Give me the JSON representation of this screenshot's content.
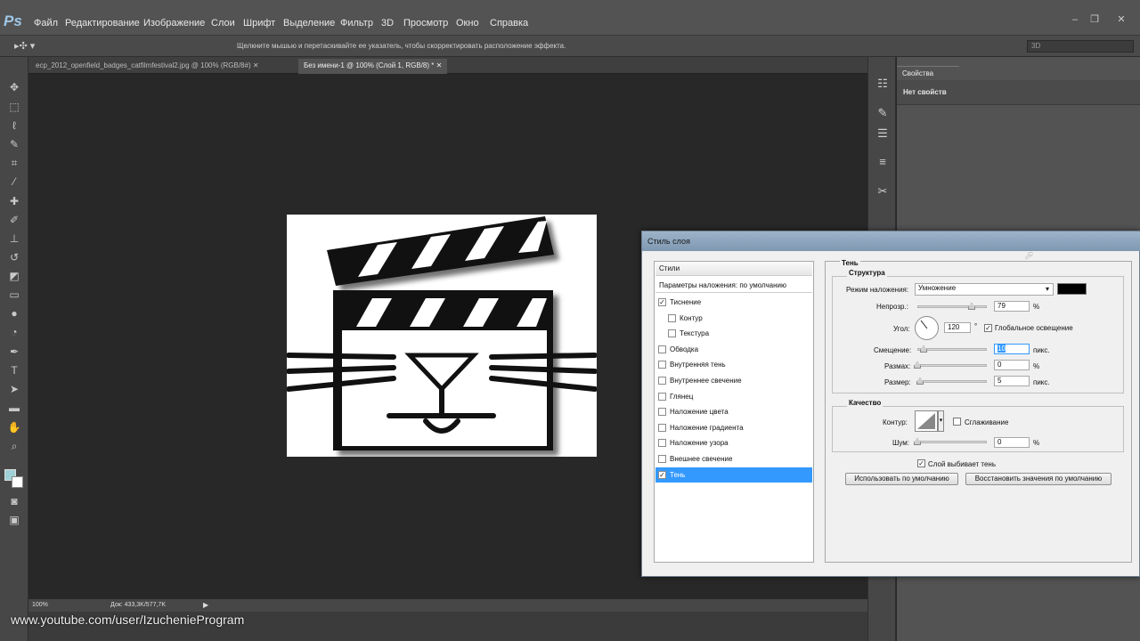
{
  "app": {
    "logo": "Ps"
  },
  "menu": [
    "Файл",
    "Редактирование",
    "Изображение",
    "Слои",
    "Шрифт",
    "Выделение",
    "Фильтр",
    "3D",
    "Просмотр",
    "Окно",
    "Справка"
  ],
  "options": {
    "hint": "Щелкните мышью и перетаскивайте ее указатель, чтобы скорректировать расположение эффекта.",
    "mode_3d": "3D"
  },
  "tabs": [
    {
      "label": "ecp_2012_openfield_badges_catfilmfestival2.jpg @ 100% (RGB/8#)"
    },
    {
      "label": "Без имени-1 @ 100% (Слой 1, RGB/8) *"
    }
  ],
  "status": {
    "zoom": "100%",
    "doc": "Док: 433,3K/577,7K"
  },
  "watermark": "www.youtube.com/user/IzuchenieProgram",
  "properties": {
    "tab": "Свойства",
    "empty": "Нет свойств"
  },
  "dialog": {
    "title": "Стиль слоя",
    "styles_header": "Стили",
    "blend_defaults": "Параметры наложения: по умолчанию",
    "styles": [
      {
        "label": "Тиснение",
        "checked": true,
        "indent": false
      },
      {
        "label": "Контур",
        "checked": false,
        "indent": true
      },
      {
        "label": "Текстура",
        "checked": false,
        "indent": true
      },
      {
        "label": "Обводка",
        "checked": false,
        "indent": false
      },
      {
        "label": "Внутренняя тень",
        "checked": false,
        "indent": false
      },
      {
        "label": "Внутреннее свечение",
        "checked": false,
        "indent": false
      },
      {
        "label": "Глянец",
        "checked": false,
        "indent": false
      },
      {
        "label": "Наложение цвета",
        "checked": false,
        "indent": false
      },
      {
        "label": "Наложение градиента",
        "checked": false,
        "indent": false
      },
      {
        "label": "Наложение узора",
        "checked": false,
        "indent": false
      },
      {
        "label": "Внешнее свечение",
        "checked": false,
        "indent": false
      },
      {
        "label": "Тень",
        "checked": true,
        "indent": false,
        "selected": true
      }
    ],
    "shadow": {
      "section": "Тень",
      "structure": "Структура",
      "blend_mode_label": "Режим наложения:",
      "blend_mode": "Умножение",
      "shadow_color": "#000000",
      "opacity_label": "Непрозр.:",
      "opacity": "79",
      "opacity_unit": "%",
      "angle_label": "Угол:",
      "angle": "120",
      "angle_unit": "°",
      "global_light_label": "Глобальное освещение",
      "global_light": true,
      "distance_label": "Смещение:",
      "distance": "10",
      "distance_unit": "пикс.",
      "spread_label": "Размах:",
      "spread": "0",
      "spread_unit": "%",
      "size_label": "Размер:",
      "size": "5",
      "size_unit": "пикс.",
      "quality": "Качество",
      "contour_label": "Контур:",
      "antialias_label": "Сглаживание",
      "noise_label": "Шум:",
      "noise": "0",
      "noise_unit": "%",
      "knockout_label": "Слой выбивает тень",
      "use_default": "Использовать по умолчанию",
      "reset_default": "Восстановить значения по умолчанию"
    }
  }
}
